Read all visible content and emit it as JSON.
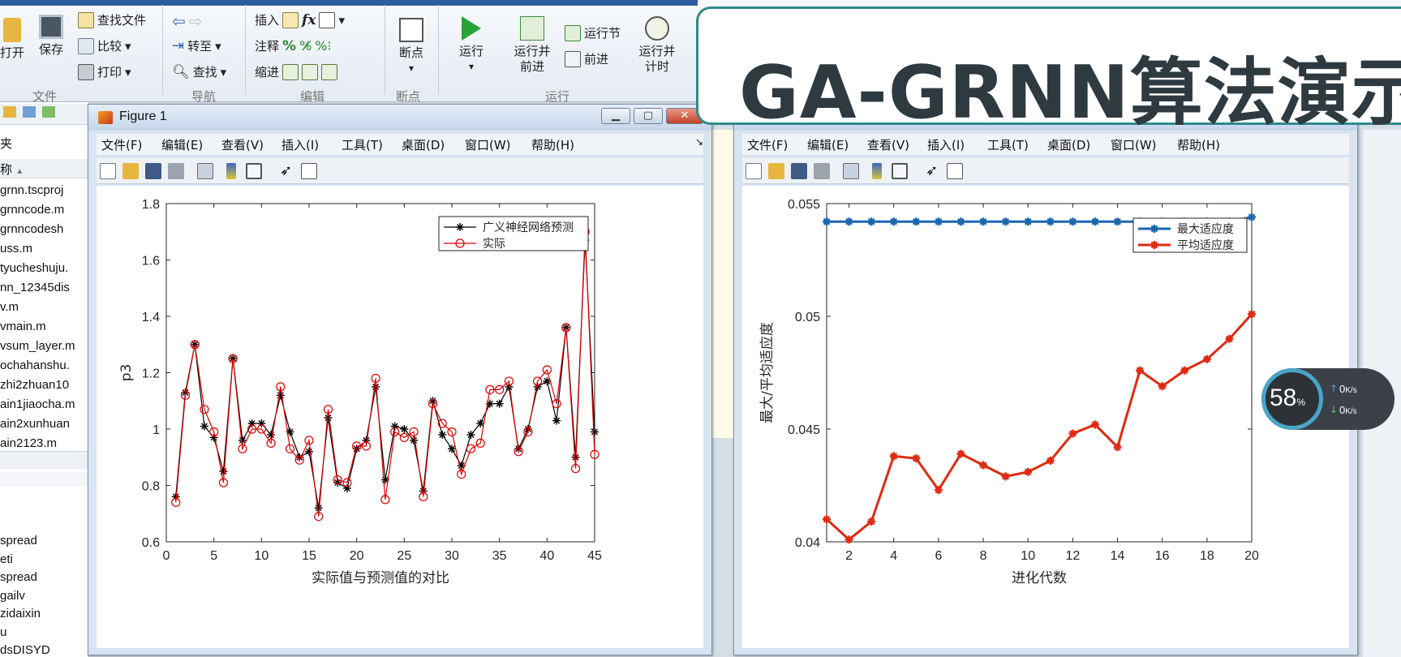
{
  "toolstrip": {
    "open": "打开",
    "save": "保存",
    "find_files": "查找文件",
    "compare": "比较",
    "print": "打印",
    "goto": "转至",
    "find": "查找",
    "insert": "插入",
    "fx": "fx",
    "comment": "注释",
    "indent": "缩进",
    "breakpoints": "断点",
    "run": "运行",
    "run_advance_l1": "运行并",
    "run_advance_l2": "前进",
    "run_section": "运行节",
    "advance": "前进",
    "run_time_l1": "运行并",
    "run_time_l2": "计时",
    "group_file": "文件",
    "group_nav": "导航",
    "group_edit": "编辑",
    "group_bp": "断点",
    "group_run": "运行"
  },
  "file_browser": {
    "header_short": "夹",
    "name_col": "称",
    "files": [
      "grnn.tscproj",
      "grnncode.m",
      "grnncodesh",
      "uss.m",
      "tyucheshuju.",
      "nn_12345dis",
      "v.m",
      "vmain.m",
      "vsum_layer.m",
      "ochahanshu.",
      "zhi2zhuan10",
      "ain1jiaocha.m",
      "ain2xunhuan",
      "ain2123.m"
    ],
    "workspace": [
      "spread",
      "eti",
      "spread",
      "gailv",
      "zidaixin",
      "u",
      "dsDISYD"
    ]
  },
  "banner": {
    "title": "GA-GRNN算法演示"
  },
  "net_widget": {
    "percent": "58",
    "percent_unit": "%",
    "up": "0",
    "down": "0",
    "unit": "K/s"
  },
  "menus": [
    "文件(F)",
    "编辑(E)",
    "查看(V)",
    "插入(I)",
    "工具(T)",
    "桌面(D)",
    "窗口(W)",
    "帮助(H)"
  ],
  "figure1": {
    "window_title": "Figure 1",
    "chart_data": {
      "type": "line",
      "xlabel": "实际值与预测值的对比",
      "ylabel": "p3",
      "xlim": [
        0,
        45
      ],
      "ylim": [
        0.6,
        1.8
      ],
      "xticks": [
        0,
        5,
        10,
        15,
        20,
        25,
        30,
        35,
        40,
        45
      ],
      "yticks": [
        0.6,
        0.8,
        1.0,
        1.2,
        1.4,
        1.6,
        1.8
      ],
      "ytick_labels": [
        "0.6",
        "0.8",
        "1",
        "1.2",
        "1.4",
        "1.6",
        "1.8"
      ],
      "legend_position": "top-right",
      "grid": false,
      "series": [
        {
          "name": "广义神经网络预测",
          "color": "#000000",
          "marker": "star",
          "x": [
            1,
            2,
            3,
            4,
            5,
            6,
            7,
            8,
            9,
            10,
            11,
            12,
            13,
            14,
            15,
            16,
            17,
            18,
            19,
            20,
            21,
            22,
            23,
            24,
            25,
            26,
            27,
            28,
            29,
            30,
            31,
            32,
            33,
            34,
            35,
            36,
            37,
            38,
            39,
            40,
            41,
            42,
            43,
            44,
            45
          ],
          "y": [
            0.76,
            1.13,
            1.3,
            1.01,
            0.97,
            0.85,
            1.25,
            0.96,
            1.02,
            1.02,
            0.98,
            1.12,
            0.99,
            0.9,
            0.92,
            0.72,
            1.04,
            0.81,
            0.79,
            0.93,
            0.96,
            1.15,
            0.82,
            1.01,
            1.0,
            0.96,
            0.78,
            1.1,
            0.98,
            0.93,
            0.87,
            0.98,
            1.02,
            1.09,
            1.09,
            1.15,
            0.93,
            1.0,
            1.15,
            1.17,
            1.03,
            1.36,
            0.9,
            1.67,
            0.99
          ]
        },
        {
          "name": "实际",
          "color": "#e00000",
          "marker": "circle",
          "x": [
            1,
            2,
            3,
            4,
            5,
            6,
            7,
            8,
            9,
            10,
            11,
            12,
            13,
            14,
            15,
            16,
            17,
            18,
            19,
            20,
            21,
            22,
            23,
            24,
            25,
            26,
            27,
            28,
            29,
            30,
            31,
            32,
            33,
            34,
            35,
            36,
            37,
            38,
            39,
            40,
            41,
            42,
            43,
            44,
            45
          ],
          "y": [
            0.74,
            1.12,
            1.3,
            1.07,
            0.99,
            0.81,
            1.25,
            0.93,
            1.0,
            1.0,
            0.95,
            1.15,
            0.93,
            0.89,
            0.96,
            0.69,
            1.07,
            0.82,
            0.81,
            0.94,
            0.94,
            1.18,
            0.75,
            0.99,
            0.97,
            0.99,
            0.76,
            1.09,
            1.02,
            0.99,
            0.84,
            0.93,
            0.95,
            1.14,
            1.14,
            1.17,
            0.92,
            0.99,
            1.17,
            1.21,
            1.09,
            1.36,
            0.86,
            1.7,
            0.91
          ]
        }
      ]
    }
  },
  "figure2": {
    "window_title": "",
    "chart_data": {
      "type": "line",
      "xlabel": "进化代数",
      "ylabel": "最大/平均适应度",
      "xlim": [
        1,
        20
      ],
      "ylim": [
        0.04,
        0.055
      ],
      "xticks": [
        2,
        4,
        6,
        8,
        10,
        12,
        14,
        16,
        18,
        20
      ],
      "yticks": [
        0.04,
        0.045,
        0.05,
        0.055
      ],
      "ytick_labels": [
        "0.04",
        "0.045",
        "0.05",
        "0.055"
      ],
      "legend_position": "top-right",
      "grid": false,
      "series": [
        {
          "name": "最大适应度",
          "color": "#1a66b0",
          "marker": "star",
          "x": [
            1,
            2,
            3,
            4,
            5,
            6,
            7,
            8,
            9,
            10,
            11,
            12,
            13,
            14,
            15,
            16,
            17,
            18,
            19,
            20
          ],
          "y": [
            0.0542,
            0.0542,
            0.0542,
            0.0542,
            0.0542,
            0.0542,
            0.0542,
            0.0542,
            0.0542,
            0.0542,
            0.0542,
            0.0542,
            0.0542,
            0.0542,
            0.0542,
            0.0542,
            0.0542,
            0.0542,
            0.0542,
            0.0544
          ]
        },
        {
          "name": "平均适应度",
          "color": "#e02a10",
          "marker": "star",
          "x": [
            1,
            2,
            3,
            4,
            5,
            6,
            7,
            8,
            9,
            10,
            11,
            12,
            13,
            14,
            15,
            16,
            17,
            18,
            19,
            20
          ],
          "y": [
            0.041,
            0.0401,
            0.0409,
            0.0438,
            0.0437,
            0.0423,
            0.0439,
            0.0434,
            0.0429,
            0.0431,
            0.0436,
            0.0448,
            0.0452,
            0.0442,
            0.0476,
            0.0469,
            0.0476,
            0.0481,
            0.049,
            0.0501
          ]
        }
      ]
    }
  }
}
